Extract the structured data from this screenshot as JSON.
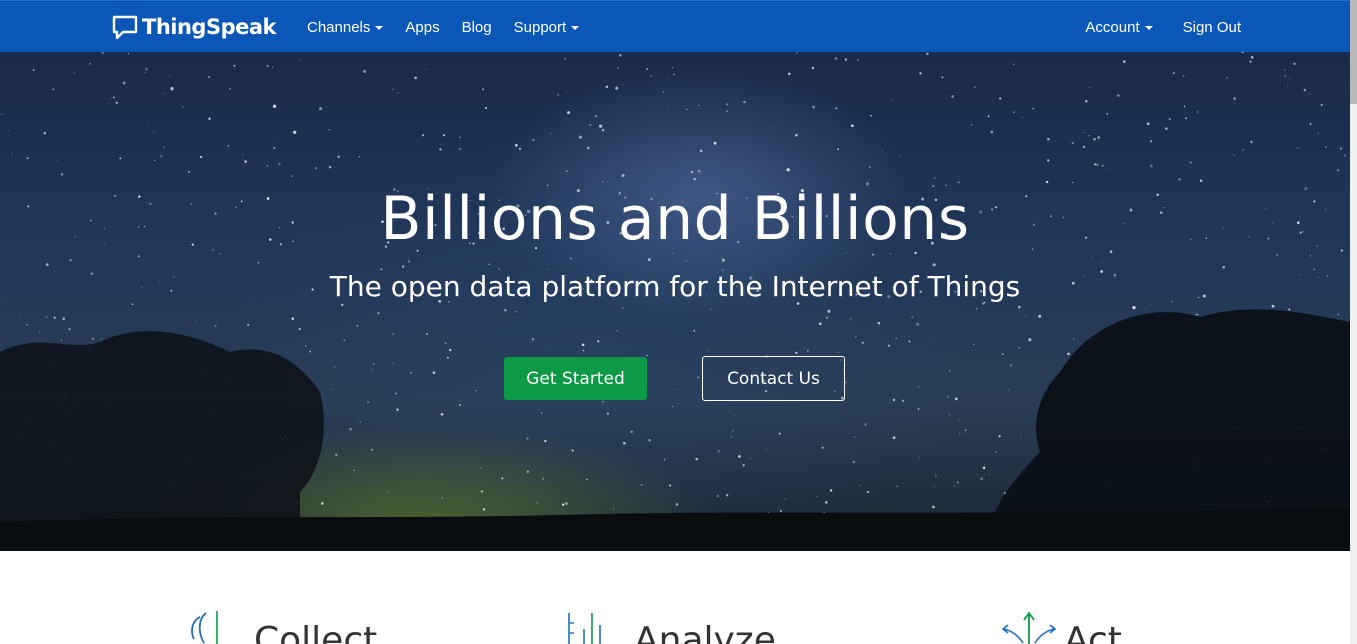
{
  "nav": {
    "brand": "ThingSpeak",
    "left_items": [
      {
        "label": "Channels",
        "dropdown": true
      },
      {
        "label": "Apps",
        "dropdown": false
      },
      {
        "label": "Blog",
        "dropdown": false
      },
      {
        "label": "Support",
        "dropdown": true
      }
    ],
    "right_items": [
      {
        "label": "Account",
        "dropdown": true
      },
      {
        "label": "Sign Out",
        "dropdown": false
      }
    ]
  },
  "hero": {
    "title": "Billions and Billions",
    "subtitle": "The open data platform for the Internet of Things",
    "primary_button": "Get Started",
    "secondary_button": "Contact Us"
  },
  "features": [
    {
      "title": "Collect",
      "icon": "collect-icon"
    },
    {
      "title": "Analyze",
      "icon": "analyze-icon"
    },
    {
      "title": "Act",
      "icon": "act-icon"
    }
  ],
  "colors": {
    "navbar": "#0b57b8",
    "primary_button": "#0c9a47",
    "icon_blue": "#1f6fc0",
    "icon_green": "#0c9a47"
  }
}
